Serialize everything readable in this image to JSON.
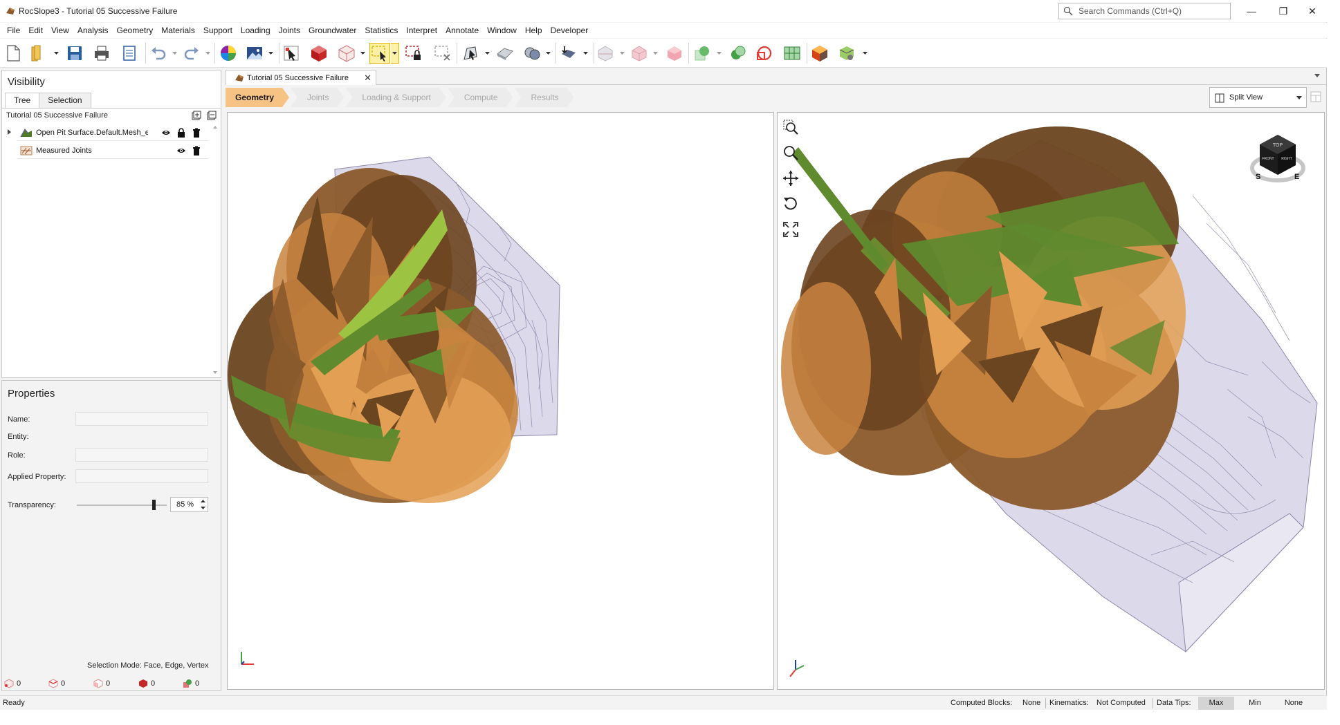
{
  "window": {
    "title": "RocSlope3 - Tutorial 05 Successive Failure",
    "search_placeholder": "Search Commands (Ctrl+Q)",
    "controls": {
      "minimize": "—",
      "restore": "❐",
      "close": "✕"
    }
  },
  "menu": [
    "File",
    "Edit",
    "View",
    "Analysis",
    "Geometry",
    "Materials",
    "Support",
    "Loading",
    "Joints",
    "Groundwater",
    "Statistics",
    "Interpret",
    "Annotate",
    "Window",
    "Help",
    "Developer"
  ],
  "toolbar": {
    "icons": [
      "new-file-icon",
      "open-folder-icon",
      "save-icon",
      "print-icon",
      "export-report-icon",
      "undo-icon",
      "redo-icon",
      "color-wheel-icon",
      "image-export-icon",
      "pick-tool-icon",
      "solid-block-icon",
      "wire-block-icon",
      "select-rectangle-icon",
      "select-lock-icon",
      "deselect-icon",
      "select-tool-icon",
      "surface-icon",
      "merge-icon",
      "support-icon",
      "cut-icon",
      "face-icon",
      "pink-block-icon",
      "green-add-icon",
      "green-subtract-icon",
      "red-intersect-icon",
      "grid-icon",
      "render-block-icon",
      "package-icon"
    ]
  },
  "visibility": {
    "title": "Visibility",
    "tabs": [
      "Tree",
      "Selection"
    ],
    "active_tab": "Tree",
    "tree_header": "Tutorial 05 Successive Failure",
    "items": [
      {
        "label": "Open Pit Surface.Default.Mesh_exte",
        "icon": "mesh-surface-icon",
        "has_lock": true
      },
      {
        "label": "Measured Joints",
        "icon": "joints-icon",
        "has_lock": false
      }
    ]
  },
  "properties": {
    "title": "Properties",
    "fields": [
      {
        "label": "Name:",
        "value": ""
      },
      {
        "label": "Entity:",
        "value": ""
      },
      {
        "label": "Role:",
        "value": ""
      },
      {
        "label": "Applied Property:",
        "value": ""
      }
    ],
    "transparency_label": "Transparency:",
    "transparency_value": "85 %",
    "transparency_level": 0.85,
    "selection_mode": "Selection Mode: Face, Edge, Vertex",
    "counters": [
      "0",
      "0",
      "0",
      "0",
      "0"
    ]
  },
  "document": {
    "tab_label": "Tutorial 05 Successive Failure",
    "close": "✕"
  },
  "workflow": {
    "steps": [
      "Geometry",
      "Joints",
      "Loading & Support",
      "Compute",
      "Results"
    ],
    "active": "Geometry"
  },
  "view": {
    "split_label": "Split View",
    "navcube": {
      "top": "TOP",
      "front": "FRONT",
      "right": "RIGHT",
      "s": "S",
      "e": "E"
    },
    "colors": {
      "joint_brown_dark": "#6b4420",
      "joint_brown": "#8a5a2b",
      "joint_orange": "#c9843f",
      "joint_light": "#e3a055",
      "joint_green": "#5f8a2e",
      "joint_lime": "#9cc442",
      "mesh_fill": "#d9d6e6",
      "mesh_line": "#8d86aa"
    }
  },
  "status": {
    "ready": "Ready",
    "computed_blocks_label": "Computed Blocks:",
    "computed_blocks_value": "None",
    "kinematics_label": "Kinematics:",
    "kinematics_value": "Not Computed",
    "data_tips_label": "Data Tips:",
    "data_tips_options": [
      "Max",
      "Min",
      "None"
    ],
    "data_tips_active": "Max"
  }
}
